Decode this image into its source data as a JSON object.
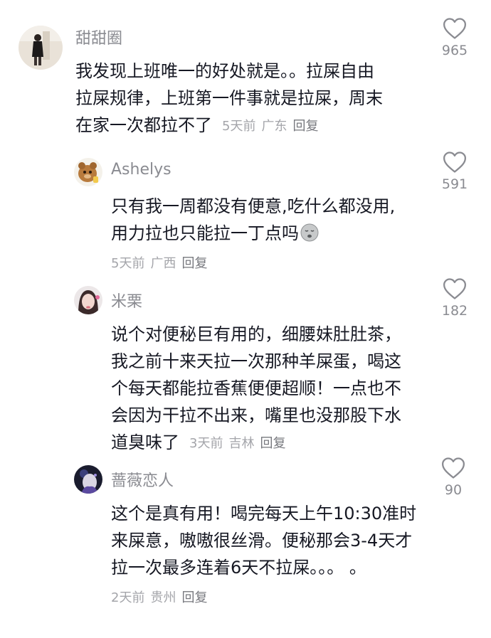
{
  "comments": [
    {
      "username": "甜甜圈",
      "lines": [
        "我发现上班唯一的好处就是。。拉屎自由",
        "拉屎规律，上班第一件事就是拉屎，周末",
        "在家一次都拉不了"
      ],
      "time": "5天前",
      "location": "广东",
      "reply_label": "回复",
      "likes": "965"
    },
    {
      "username": "Ashelys",
      "lines": [
        "只有我一周都没有便意,吃什么都没用,",
        "用力拉也只能拉一丁点吗"
      ],
      "time": "5天前",
      "location": "广西",
      "reply_label": "回复",
      "likes": "591"
    },
    {
      "username": "米栗",
      "lines": [
        "说个对便秘巨有用的，细腰妹肚肚茶，",
        "我之前十来天拉一次那种羊屎蛋，喝这",
        "个每天都能拉香蕉便便超顺！一点也不",
        "会因为干拉不出来，嘴里也没那股下水",
        "道臭味了"
      ],
      "time": "3天前",
      "location": "吉林",
      "reply_label": "回复",
      "likes": "182"
    },
    {
      "username": "蔷薇恋人",
      "lines": [
        "这个是真有用！喝完每天上午10:30准时",
        "来屎意，嗷嗷很丝滑。便秘那会3-4天才",
        "拉一次最多连着6天不拉屎。。。 。"
      ],
      "time": "2天前",
      "location": "贵州",
      "reply_label": "回复",
      "likes": "90"
    }
  ],
  "icons": {
    "like": "heart-outline-icon",
    "emoji": "pensive-face-emoji"
  },
  "colors": {
    "text": "#161823",
    "username": "#8a8b91",
    "meta": "#a4a5aa"
  }
}
